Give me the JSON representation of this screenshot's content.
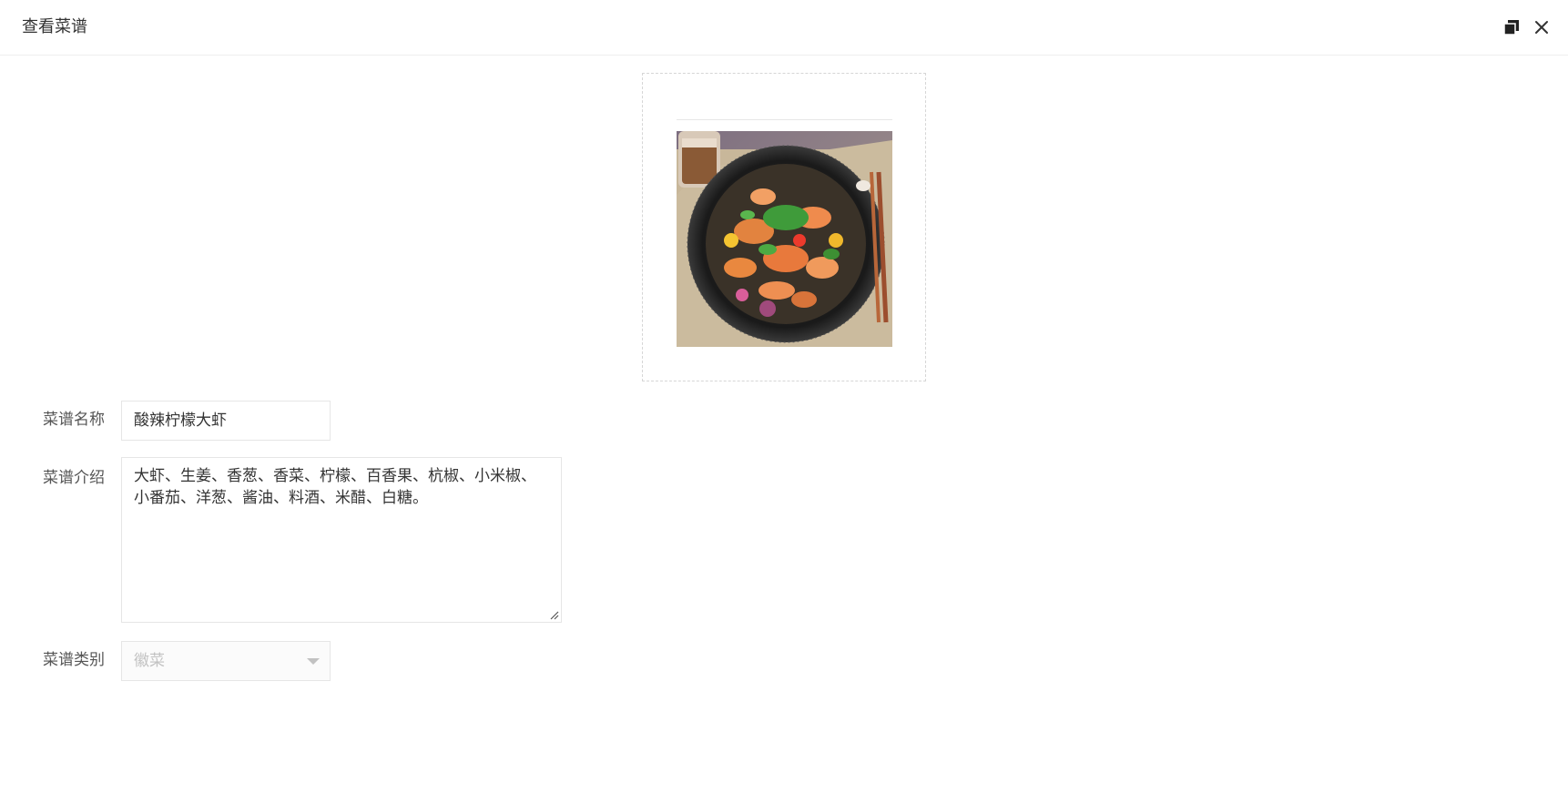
{
  "dialog": {
    "title": "查看菜谱",
    "maximize_icon": "maximize-icon",
    "close_icon": "close-icon"
  },
  "recipe": {
    "photo_label": "recipe-photo",
    "name_label": "菜谱名称",
    "name_value": "酸辣柠檬大虾",
    "intro_label": "菜谱介绍",
    "intro_value": "大虾、生姜、香葱、香菜、柠檬、百香果、杭椒、小米椒、小番茄、洋葱、酱油、料酒、米醋、白糖。",
    "category_label": "菜谱类别",
    "category_value": "徽菜"
  },
  "colors": {
    "border": "#e6e6e6",
    "label_text": "#555555",
    "disabled_text": "#c2c2c2"
  }
}
